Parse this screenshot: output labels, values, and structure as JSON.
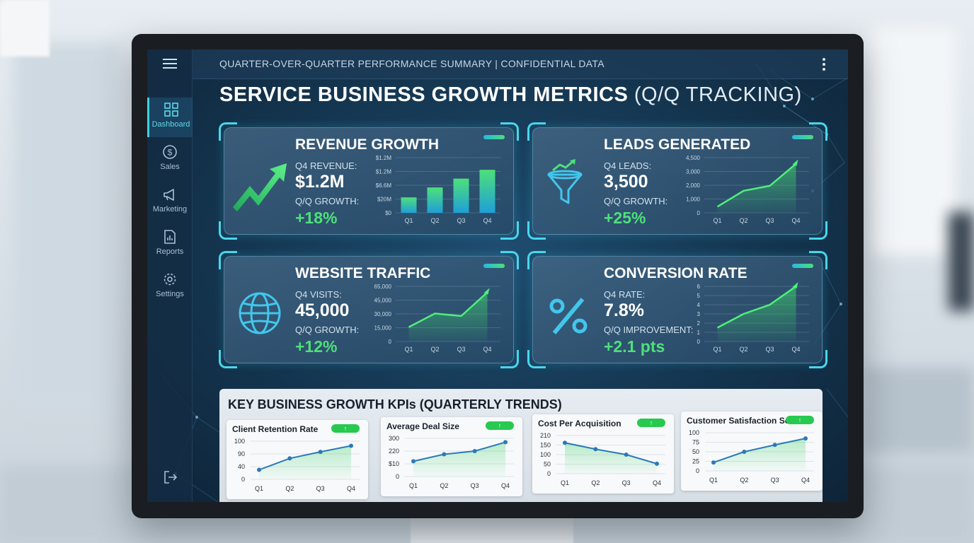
{
  "topbar": {
    "title": "QUARTER-OVER-QUARTER PERFORMANCE SUMMARY  |  CONFIDENTIAL DATA"
  },
  "page": {
    "title_main": "SERVICE BUSINESS GROWTH METRICS",
    "title_suffix": " (Q/Q TRACKING)"
  },
  "sidebar": {
    "items": [
      {
        "label": "Dashboard",
        "icon": "grid-icon",
        "active": true
      },
      {
        "label": "Sales",
        "icon": "dollar-icon",
        "active": false
      },
      {
        "label": "Marketing",
        "icon": "megaphone-icon",
        "active": false
      },
      {
        "label": "Reports",
        "icon": "report-icon",
        "active": false
      },
      {
        "label": "Settings",
        "icon": "gear-icon",
        "active": false
      }
    ],
    "exit_icon": "logout-icon"
  },
  "colors": {
    "accent": "#49d6ec",
    "growth": "#4ee07a",
    "chart_line": "#3fdc6a",
    "mini_line": "#2c79b8"
  },
  "cards": {
    "revenue": {
      "title": "REVENUE GROWTH",
      "metric_label": "Q4 REVENUE:",
      "metric_value": "$1.2M",
      "growth_label": "Q/Q GROWTH:",
      "growth_value": "+18%",
      "icon": "trend-arrow-icon"
    },
    "leads": {
      "title": "LEADS GENERATED",
      "metric_label": "Q4 LEADS:",
      "metric_value": "3,500",
      "growth_label": "Q/Q GROWTH:",
      "growth_value": "+25%",
      "icon": "funnel-icon"
    },
    "traffic": {
      "title": "WEBSITE TRAFFIC",
      "metric_label": "Q4 VISITS:",
      "metric_value": "45,000",
      "growth_label": "Q/Q GROWTH:",
      "growth_value": "+12%",
      "icon": "globe-icon"
    },
    "conversion": {
      "title": "CONVERSION RATE",
      "metric_label": "Q4 RATE:",
      "metric_value": "7.8%",
      "growth_label": "Q/Q IMPROVEMENT:",
      "growth_value": "+2.1 pts",
      "icon": "percent-icon"
    }
  },
  "bottom": {
    "title": "KEY BUSINESS GROWTH KPIs (QUARTERLY TRENDS)",
    "badge": "↑"
  },
  "chart_data": [
    {
      "id": "revenue",
      "type": "bar",
      "categories": [
        "Q1",
        "Q2",
        "Q3",
        "Q4"
      ],
      "values": [
        0.28,
        0.46,
        0.62,
        0.78
      ],
      "ytick_labels": [
        "$1.2M",
        "$1.2M",
        "$6.6M",
        "$20M",
        "$0"
      ],
      "title": "",
      "xlabel": "",
      "ylabel": ""
    },
    {
      "id": "leads",
      "type": "area",
      "categories": [
        "Q1",
        "Q2",
        "Q3",
        "Q4"
      ],
      "values": [
        500,
        1800,
        2200,
        4000
      ],
      "ylim": [
        0,
        4500
      ],
      "ytick_labels": [
        "4,500",
        "3,000",
        "2,000",
        "1,000",
        "0"
      ],
      "title": "",
      "xlabel": "",
      "ylabel": ""
    },
    {
      "id": "traffic",
      "type": "area",
      "categories": [
        "Q1",
        "Q2",
        "Q3",
        "Q4"
      ],
      "values": [
        17000,
        33000,
        30000,
        58000
      ],
      "ylim": [
        0,
        65000
      ],
      "ytick_labels": [
        "65,000",
        "45,000",
        "30,000",
        "15,000",
        "0"
      ],
      "title": "",
      "xlabel": "",
      "ylabel": ""
    },
    {
      "id": "conversion",
      "type": "area",
      "categories": [
        "Q1",
        "Q2",
        "Q3",
        "Q4"
      ],
      "values": [
        1.5,
        3.0,
        4.0,
        6.2
      ],
      "ylim": [
        0,
        6
      ],
      "ytick_labels": [
        "6",
        "5",
        "4",
        "3",
        "2",
        "1",
        "0"
      ],
      "title": "",
      "xlabel": "",
      "ylabel": ""
    },
    {
      "id": "retention",
      "type": "line",
      "title": "Client Retention Rate",
      "categories": [
        "Q1",
        "Q2",
        "Q3",
        "Q4"
      ],
      "values": [
        25,
        55,
        72,
        88
      ],
      "ylim": [
        0,
        100
      ],
      "ytick_labels": [
        "100",
        "90",
        "40",
        "0"
      ]
    },
    {
      "id": "deal",
      "type": "line",
      "title": "Average Deal Size",
      "categories": [
        "Q1",
        "Q2",
        "Q3",
        "Q4"
      ],
      "values": [
        120,
        175,
        200,
        270
      ],
      "ylim": [
        0,
        300
      ],
      "ytick_labels": [
        "300",
        "220",
        "$10",
        "0"
      ]
    },
    {
      "id": "cpa",
      "type": "line",
      "title": "Cost Per Acquisition",
      "categories": [
        "Q1",
        "Q2",
        "Q3",
        "Q4"
      ],
      "values": [
        170,
        135,
        105,
        55
      ],
      "ylim": [
        0,
        210
      ],
      "ytick_labels": [
        "210",
        "150",
        "100",
        "50",
        "0"
      ]
    },
    {
      "id": "csat",
      "type": "line",
      "title": "Customer Satisfaction Score",
      "categories": [
        "Q1",
        "Q2",
        "Q3",
        "Q4"
      ],
      "values": [
        22,
        50,
        68,
        85
      ],
      "ylim": [
        0,
        100
      ],
      "ytick_labels": [
        "100",
        "75",
        "50",
        "25",
        "0"
      ]
    }
  ]
}
